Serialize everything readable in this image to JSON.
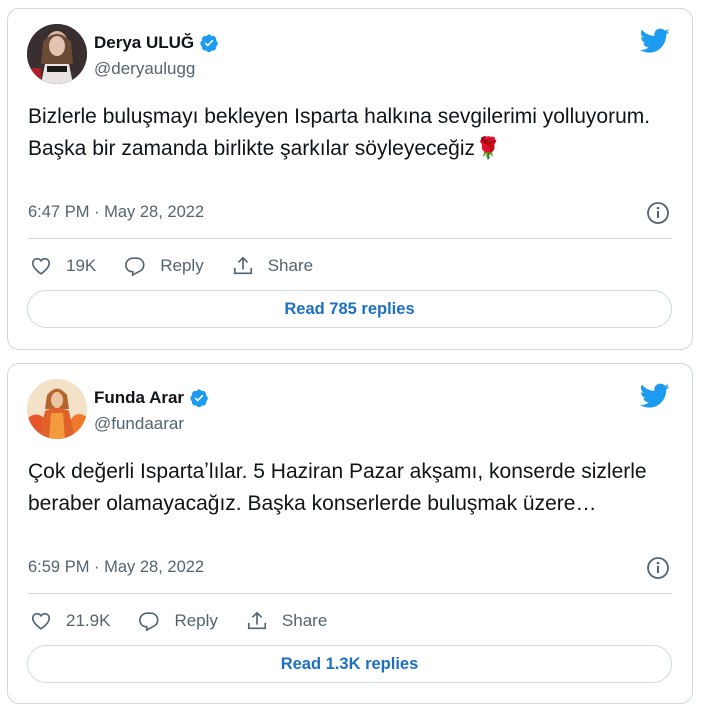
{
  "tweets": [
    {
      "name": "Derya ULUĞ",
      "handle": "@deryaulugg",
      "text": "Bizlerle buluşmayı bekleyen Isparta halkına sevgilerimi yolluyorum. Başka bir zamanda birlikte şarkılar söyleyeceğiz🌹",
      "timestamp": "6:47 PM · May 28, 2022",
      "likes": "19K",
      "reply_label": "Reply",
      "share_label": "Share",
      "read_replies": "Read 785 replies"
    },
    {
      "name": "Funda Arar",
      "handle": "@fundaarar",
      "text": "Çok değerli Ispartaʼlılar. 5 Haziran Pazar akşamı, konserde sizlerle beraber olamayacağız. Başka konserlerde buluşmak üzere…",
      "timestamp": "6:59 PM · May 28, 2022",
      "likes": "21.9K",
      "reply_label": "Reply",
      "share_label": "Share",
      "read_replies": "Read 1.3K replies"
    }
  ],
  "colors": {
    "twitter_blue": "#1d9bf0",
    "link_blue": "#1d6fc2",
    "secondary_text": "#536471",
    "border": "#cfd9de"
  },
  "icons": [
    "twitter-bird-icon",
    "verified-badge-icon",
    "info-icon",
    "heart-icon",
    "reply-icon",
    "share-icon"
  ]
}
